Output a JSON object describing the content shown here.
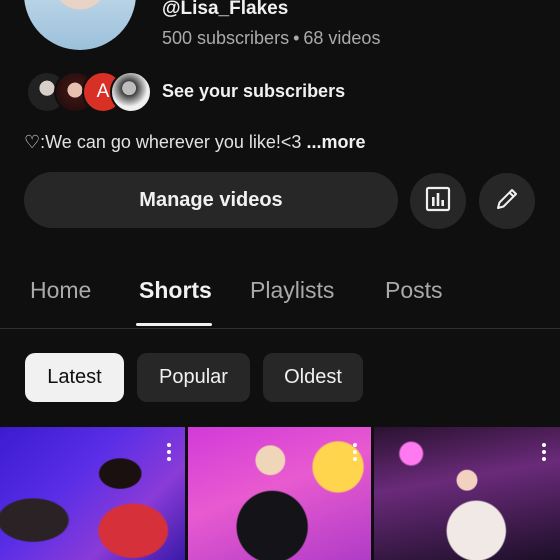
{
  "channel": {
    "handle": "@Lisa_Flakes",
    "subscribers": "500 subscribers",
    "separator": "•",
    "videos": "68 videos",
    "see_subscribers": "See your subscribers",
    "subscriber_avatar_letter": "A",
    "bio": "♡:We can go wherever you like!<3",
    "bio_more": "...more"
  },
  "actions": {
    "manage_videos": "Manage videos",
    "analytics_icon": "analytics-icon",
    "edit_icon": "pencil-icon"
  },
  "tabs": [
    {
      "label": "Home"
    },
    {
      "label": "Shorts"
    },
    {
      "label": "Playlists"
    },
    {
      "label": "Posts"
    }
  ],
  "filters": [
    {
      "label": "Latest"
    },
    {
      "label": "Popular"
    },
    {
      "label": "Oldest"
    }
  ],
  "colors": {
    "background": "#0f0f0f",
    "button": "#272727",
    "chip_selected": "#f1f1f1",
    "text_secondary": "#aaaaaa"
  }
}
